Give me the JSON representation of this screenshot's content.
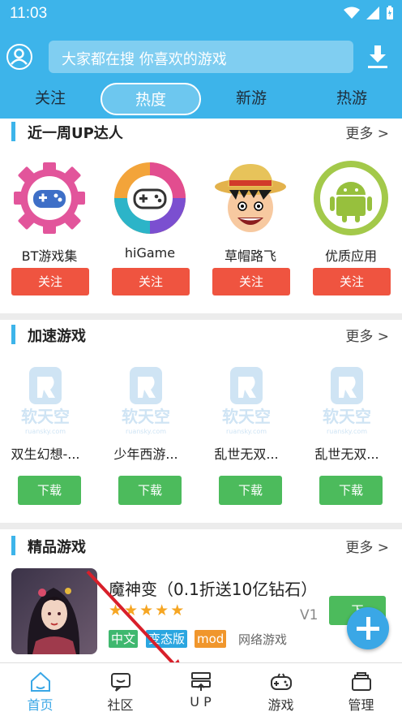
{
  "status": {
    "time": "11:03"
  },
  "search": {
    "placeholder": "大家都在搜  你喜欢的游戏"
  },
  "tabs": [
    {
      "label": "关注"
    },
    {
      "label": "热度"
    },
    {
      "label": "新游"
    },
    {
      "label": "热游"
    }
  ],
  "up_section": {
    "title": "近一周UP达人",
    "more": "更多 >",
    "items": [
      {
        "name": "BT游戏集",
        "button": "关注"
      },
      {
        "name": "hiGame",
        "button": "关注"
      },
      {
        "name": "草帽路飞",
        "button": "关注"
      },
      {
        "name": "优质应用",
        "button": "关注"
      }
    ]
  },
  "speed_section": {
    "title": "加速游戏",
    "more": "更多 >",
    "logo_text": "软天空",
    "logo_sub": "ruansky.com",
    "items": [
      {
        "name": "双生幻想-...",
        "button": "下载"
      },
      {
        "name": "少年西游...",
        "button": "下载"
      },
      {
        "name": "乱世无双...",
        "button": "下载"
      },
      {
        "name": "乱世无双...",
        "button": "下载"
      }
    ]
  },
  "featured_section": {
    "title": "精品游戏",
    "more": "更多 >",
    "game": {
      "name": "魔神变（0.1折送10亿钻石）",
      "rating_stars": 5,
      "version": "V1",
      "tags": [
        "中文",
        "变态版",
        "mod"
      ],
      "category": "网络游戏",
      "button": "下"
    }
  },
  "colors": {
    "primary": "#3db4ea",
    "follow": "#ef5440",
    "download": "#4cbb5c",
    "tag_chinese": "#3fb86f",
    "tag_bt": "#2aa6e0",
    "tag_mod": "#f0962c"
  },
  "bottom_nav": [
    {
      "label": "首页",
      "icon": "home-icon",
      "active": true
    },
    {
      "label": "社区",
      "icon": "community-icon"
    },
    {
      "label": "U P",
      "icon": "up-icon"
    },
    {
      "label": "游戏",
      "icon": "gamepad-icon"
    },
    {
      "label": "管理",
      "icon": "manage-icon"
    }
  ]
}
